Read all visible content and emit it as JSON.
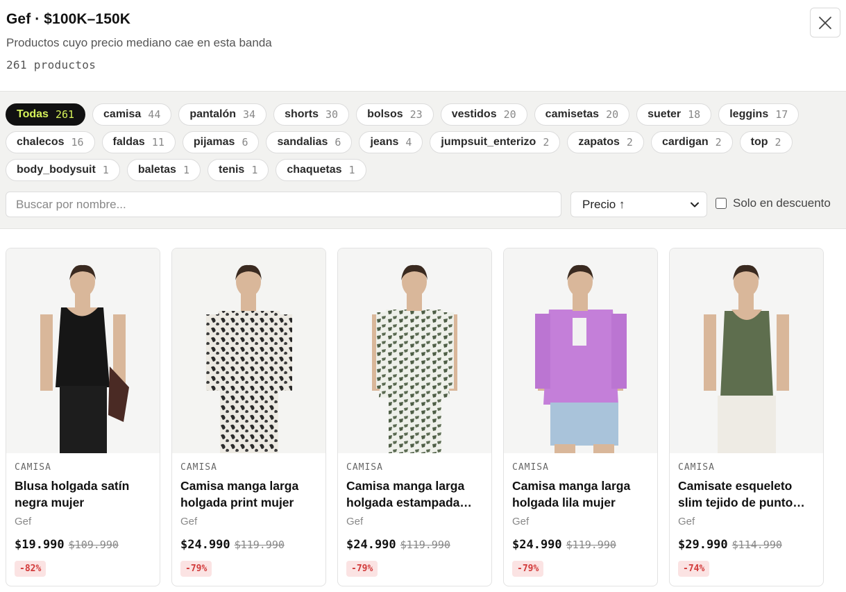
{
  "header": {
    "title": "Gef · $100K–150K",
    "subtitle": "Productos cuyo precio mediano cae en esta banda",
    "count": "261 productos"
  },
  "categories": [
    {
      "label": "Todas",
      "count": "261"
    },
    {
      "label": "camisa",
      "count": "44"
    },
    {
      "label": "pantalón",
      "count": "34"
    },
    {
      "label": "shorts",
      "count": "30"
    },
    {
      "label": "bolsos",
      "count": "23"
    },
    {
      "label": "vestidos",
      "count": "20"
    },
    {
      "label": "camisetas",
      "count": "20"
    },
    {
      "label": "sueter",
      "count": "18"
    },
    {
      "label": "leggins",
      "count": "17"
    },
    {
      "label": "chalecos",
      "count": "16"
    },
    {
      "label": "faldas",
      "count": "11"
    },
    {
      "label": "pijamas",
      "count": "6"
    },
    {
      "label": "sandalias",
      "count": "6"
    },
    {
      "label": "jeans",
      "count": "4"
    },
    {
      "label": "jumpsuit_enterizo",
      "count": "2"
    },
    {
      "label": "zapatos",
      "count": "2"
    },
    {
      "label": "cardigan",
      "count": "2"
    },
    {
      "label": "top",
      "count": "2"
    },
    {
      "label": "body_bodysuit",
      "count": "1"
    },
    {
      "label": "baletas",
      "count": "1"
    },
    {
      "label": "tenis",
      "count": "1"
    },
    {
      "label": "chaquetas",
      "count": "1"
    }
  ],
  "search": {
    "placeholder": "Buscar por nombre...",
    "value": ""
  },
  "sort": {
    "label": "Precio ↑"
  },
  "discount_filter": {
    "label": "Solo en descuento",
    "checked": false
  },
  "products": [
    {
      "category": "CAMISA",
      "name": "Blusa holgada satín negra mujer",
      "brand": "Gef",
      "price": "$19.990",
      "old_price": "$109.990",
      "discount": "-82%",
      "look": "black-satin"
    },
    {
      "category": "CAMISA",
      "name": "Camisa manga larga holgada print mujer",
      "brand": "Gef",
      "price": "$24.990",
      "old_price": "$119.990",
      "discount": "-79%",
      "look": "bw-print"
    },
    {
      "category": "CAMISA",
      "name": "Camisa manga larga holgada estampada mujer",
      "brand": "Gef",
      "price": "$24.990",
      "old_price": "$119.990",
      "discount": "-79%",
      "look": "olive-print"
    },
    {
      "category": "CAMISA",
      "name": "Camisa manga larga holgada lila mujer",
      "brand": "Gef",
      "price": "$24.990",
      "old_price": "$119.990",
      "discount": "-79%",
      "look": "lilac"
    },
    {
      "category": "CAMISA",
      "name": "Camisate esqueleto slim tejido de punto mujer",
      "brand": "Gef",
      "price": "$29.990",
      "old_price": "$114.990",
      "discount": "-74%",
      "look": "olive-tank"
    }
  ],
  "colors": {
    "accent": "#d6f25a",
    "active_chip": "#111111",
    "discount_bg": "#fbe3e3",
    "discount_text": "#d23a3a",
    "filter_bg": "#f2f2f0"
  }
}
